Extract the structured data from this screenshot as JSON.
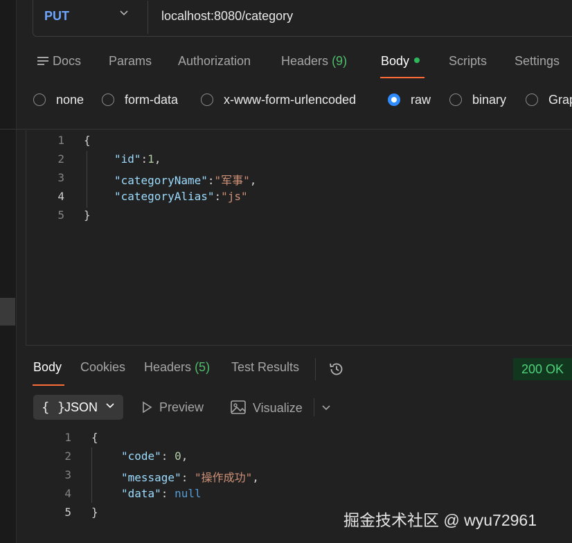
{
  "request": {
    "method": "PUT",
    "url": "localhost:8080/category"
  },
  "tabs": [
    {
      "label": "Docs"
    },
    {
      "label": "Params"
    },
    {
      "label": "Authorization"
    },
    {
      "label": "Headers",
      "count": "(9)"
    },
    {
      "label": "Body",
      "active": true
    },
    {
      "label": "Scripts"
    },
    {
      "label": "Settings"
    }
  ],
  "body_types": [
    {
      "label": "none"
    },
    {
      "label": "form-data"
    },
    {
      "label": "x-www-form-urlencoded"
    },
    {
      "label": "raw",
      "checked": true
    },
    {
      "label": "binary"
    },
    {
      "label": "Grap"
    }
  ],
  "request_body": {
    "line_numbers": [
      "1",
      "2",
      "3",
      "4",
      "5"
    ],
    "open_brace": "{",
    "close_brace": "}",
    "fields": [
      {
        "key": "\"id\"",
        "colon": ":",
        "value": "1",
        "tail": ","
      },
      {
        "key": "\"categoryName\"",
        "colon": ":",
        "value": "\"军事\"",
        "tail": ","
      },
      {
        "key": "\"categoryAlias\"",
        "colon": ":",
        "value": "\"js\"",
        "tail": ""
      }
    ]
  },
  "response_tabs": [
    {
      "label": "Body",
      "active": true
    },
    {
      "label": "Cookies"
    },
    {
      "label": "Headers",
      "count": "(5)"
    },
    {
      "label": "Test Results"
    }
  ],
  "response_status": "200 OK",
  "response_toolbar": {
    "format_braces": "{ }",
    "format_label": "JSON",
    "preview_label": "Preview",
    "visualize_label": "Visualize"
  },
  "response_body": {
    "line_numbers": [
      "1",
      "2",
      "3",
      "4",
      "5"
    ],
    "open_brace": "{",
    "close_brace": "}",
    "fields": [
      {
        "key": "\"code\"",
        "colon": ": ",
        "value": "0",
        "tail": ","
      },
      {
        "key": "\"message\"",
        "colon": ": ",
        "value": "\"操作成功\"",
        "tail": ","
      },
      {
        "key": "\"data\"",
        "colon": ": ",
        "value": "null",
        "tail": ""
      }
    ]
  },
  "watermark": "掘金技术社区 @ wyu72961",
  "colors": {
    "method": "#6ea5ff",
    "accent_underline": "#ff6c37",
    "success_green": "#4fbf6b",
    "radio_checked": "#2f8cff",
    "json_key": "#9cdcfe",
    "json_string": "#ce9178",
    "json_number": "#b5cea8",
    "json_null": "#569cd6"
  }
}
